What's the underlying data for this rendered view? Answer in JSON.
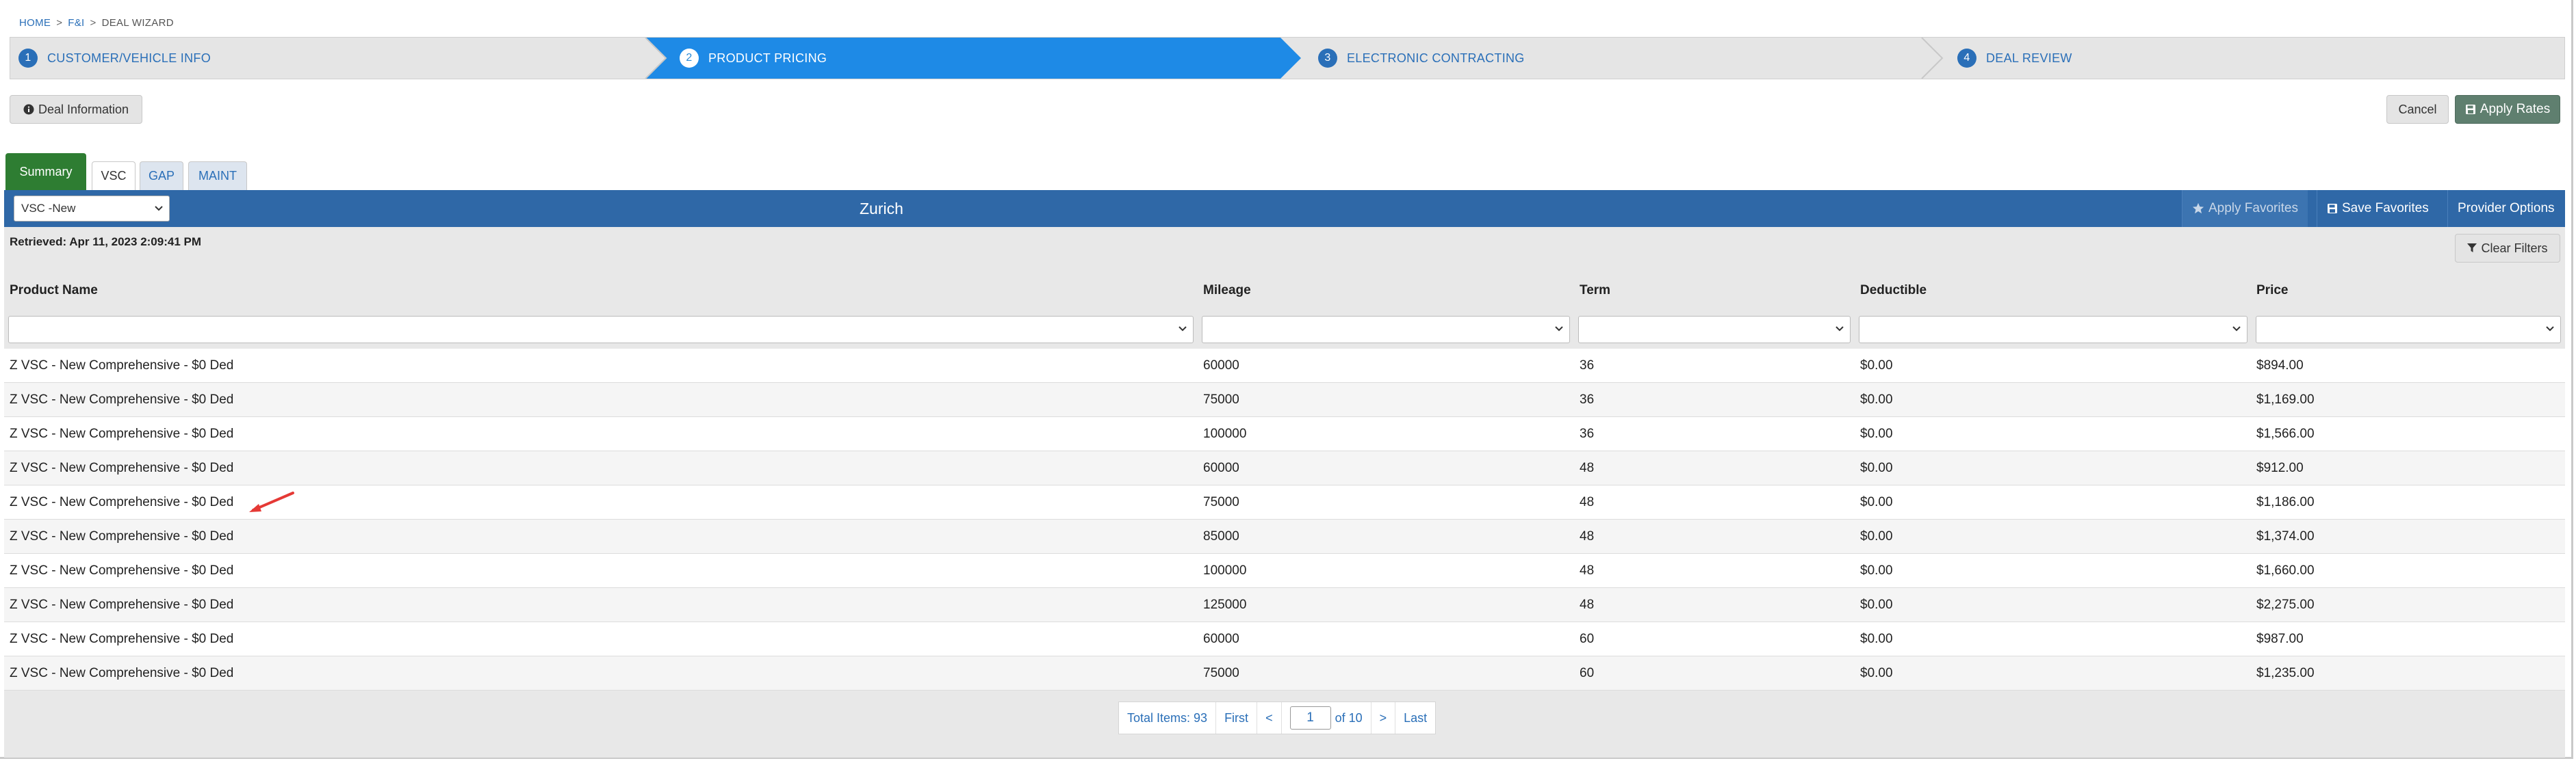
{
  "breadcrumb": {
    "home": "HOME",
    "fi": "F&I",
    "current": "DEAL WIZARD",
    "sep": ">"
  },
  "wizard": {
    "steps": [
      {
        "num": "1",
        "label": "CUSTOMER/VEHICLE INFO"
      },
      {
        "num": "2",
        "label": "PRODUCT PRICING"
      },
      {
        "num": "3",
        "label": "ELECTRONIC CONTRACTING"
      },
      {
        "num": "4",
        "label": "DEAL REVIEW"
      }
    ],
    "active_index": 1,
    "active_color": "#1e8ae6"
  },
  "toolbar": {
    "deal_info_label": "Deal Information",
    "cancel_label": "Cancel",
    "apply_rates_label": "Apply Rates"
  },
  "tabs": {
    "summary": "Summary",
    "vsc": "VSC",
    "gap": "GAP",
    "maint": "MAINT"
  },
  "provider_bar": {
    "select_value": "VSC -New",
    "provider_name": "Zurich",
    "apply_favorites": "Apply Favorites",
    "save_favorites": "Save Favorites",
    "provider_options": "Provider Options",
    "bar_color": "#2f68a7"
  },
  "retrieved": "Retrieved: Apr 11, 2023 2:09:41 PM",
  "clear_filters": "Clear Filters",
  "table": {
    "headers": {
      "product": "Product Name",
      "mileage": "Mileage",
      "term": "Term",
      "deductible": "Deductible",
      "price": "Price"
    },
    "rows": [
      {
        "product": "Z VSC - New Comprehensive - $0 Ded",
        "mileage": "60000",
        "term": "36",
        "deductible": "$0.00",
        "price": "$894.00"
      },
      {
        "product": "Z VSC - New Comprehensive - $0 Ded",
        "mileage": "75000",
        "term": "36",
        "deductible": "$0.00",
        "price": "$1,169.00"
      },
      {
        "product": "Z VSC - New Comprehensive - $0 Ded",
        "mileage": "100000",
        "term": "36",
        "deductible": "$0.00",
        "price": "$1,566.00"
      },
      {
        "product": "Z VSC - New Comprehensive - $0 Ded",
        "mileage": "60000",
        "term": "48",
        "deductible": "$0.00",
        "price": "$912.00"
      },
      {
        "product": "Z VSC - New Comprehensive - $0 Ded",
        "mileage": "75000",
        "term": "48",
        "deductible": "$0.00",
        "price": "$1,186.00"
      },
      {
        "product": "Z VSC - New Comprehensive - $0 Ded",
        "mileage": "85000",
        "term": "48",
        "deductible": "$0.00",
        "price": "$1,374.00"
      },
      {
        "product": "Z VSC - New Comprehensive - $0 Ded",
        "mileage": "100000",
        "term": "48",
        "deductible": "$0.00",
        "price": "$1,660.00"
      },
      {
        "product": "Z VSC - New Comprehensive - $0 Ded",
        "mileage": "125000",
        "term": "48",
        "deductible": "$0.00",
        "price": "$2,275.00"
      },
      {
        "product": "Z VSC - New Comprehensive - $0 Ded",
        "mileage": "60000",
        "term": "60",
        "deductible": "$0.00",
        "price": "$987.00"
      },
      {
        "product": "Z VSC - New Comprehensive - $0 Ded",
        "mileage": "75000",
        "term": "60",
        "deductible": "$0.00",
        "price": "$1,235.00"
      }
    ]
  },
  "pager": {
    "total": "Total Items: 93",
    "first": "First",
    "prev": "<",
    "page": "1",
    "of": "of 10",
    "next": ">",
    "last": "Last"
  },
  "annotation": {
    "arrow_color": "#e53935"
  }
}
